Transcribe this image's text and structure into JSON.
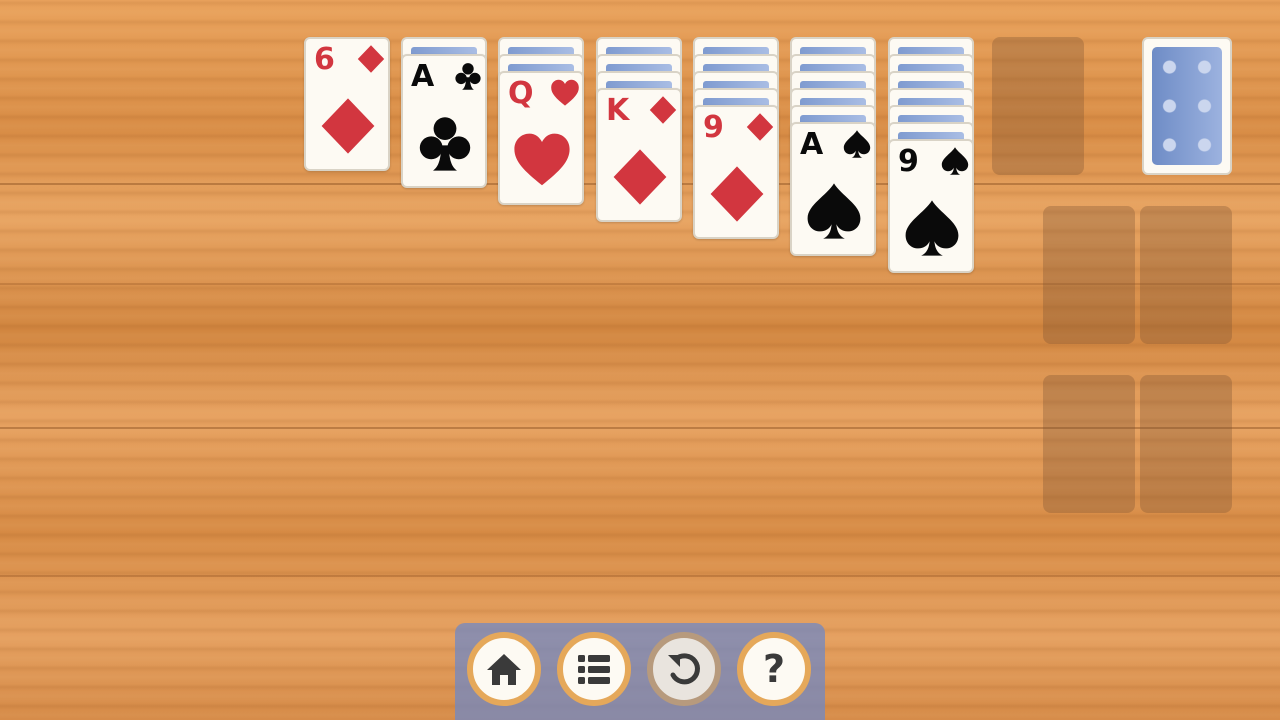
{
  "tableau": [
    {
      "face_down": 0,
      "rank": "6",
      "suit": "diamond",
      "color": "red"
    },
    {
      "face_down": 1,
      "rank": "A",
      "suit": "club",
      "color": "black"
    },
    {
      "face_down": 2,
      "rank": "Q",
      "suit": "heart",
      "color": "red"
    },
    {
      "face_down": 3,
      "rank": "K",
      "suit": "diamond",
      "color": "red"
    },
    {
      "face_down": 4,
      "rank": "9",
      "suit": "diamond",
      "color": "red"
    },
    {
      "face_down": 5,
      "rank": "A",
      "suit": "spade",
      "color": "black"
    },
    {
      "face_down": 6,
      "rank": "9",
      "suit": "spade",
      "color": "black"
    }
  ],
  "waste_pile": "empty",
  "stock_pile": "card-back",
  "foundations": [
    "empty",
    "empty",
    "empty",
    "empty"
  ],
  "toolbar": [
    {
      "name": "home-button",
      "icon": "home-icon"
    },
    {
      "name": "menu-button",
      "icon": "list-icon"
    },
    {
      "name": "undo-button",
      "icon": "undo-icon",
      "disabled": true
    },
    {
      "name": "help-button",
      "icon": "help-icon",
      "label": "?"
    }
  ],
  "colors": {
    "red": "#d2363f",
    "black": "#0a0a0a",
    "toolbar": "#7088c4",
    "button_ring": "#e5a85a"
  }
}
